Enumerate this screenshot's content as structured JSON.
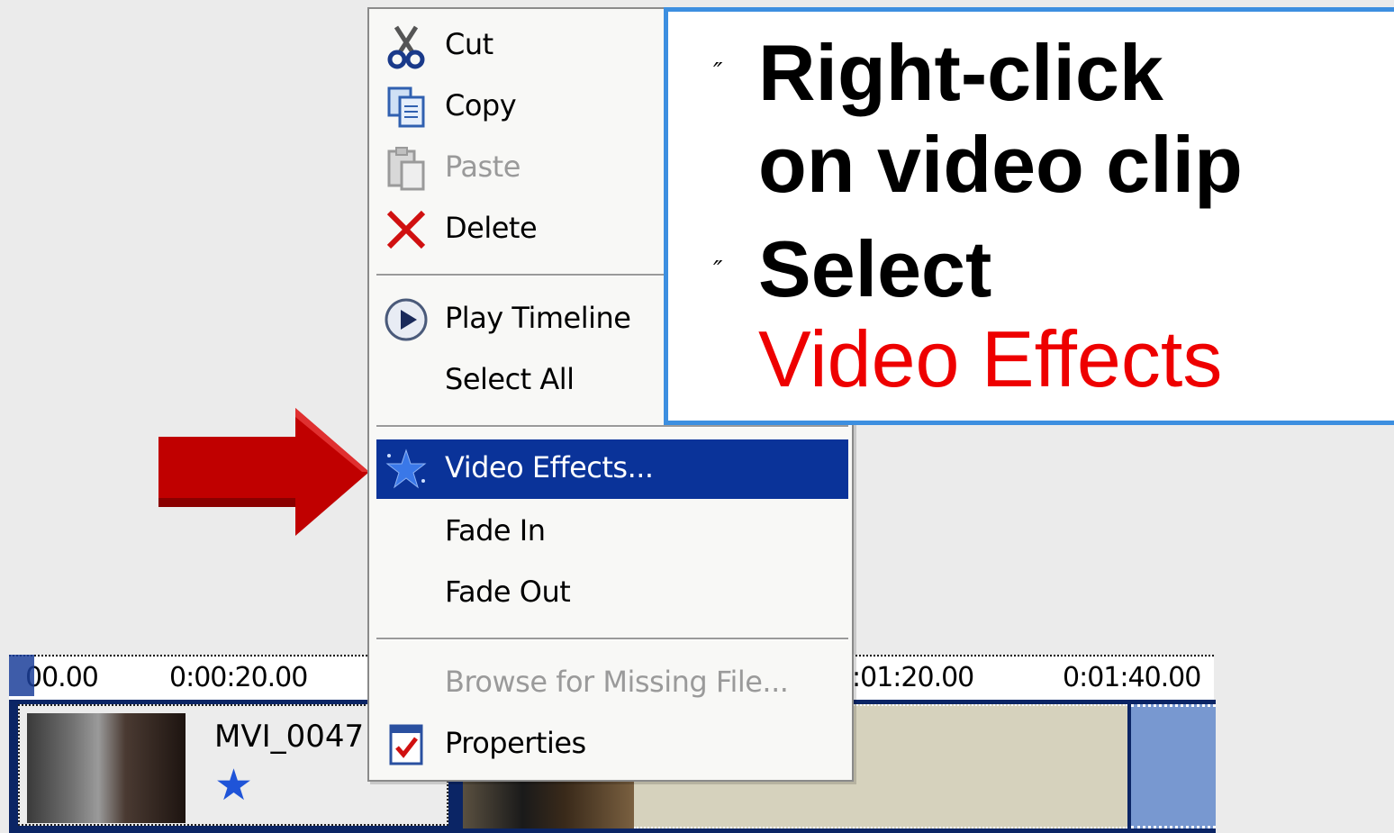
{
  "timeline": {
    "ruler_labels": [
      "00.00",
      "0:00:20.00",
      ":01:20.00",
      "0:01:40.00"
    ],
    "clip1_name": "MVI_0047",
    "effect_icon": "star-icon"
  },
  "context_menu": {
    "items": [
      {
        "label": "Cut",
        "icon": "scissors-icon",
        "enabled": true
      },
      {
        "label": "Copy",
        "icon": "copy-icon",
        "enabled": true
      },
      {
        "label": "Paste",
        "icon": "paste-icon",
        "enabled": false
      },
      {
        "label": "Delete",
        "icon": "delete-x-icon",
        "enabled": true
      },
      {
        "label": "Play Timeline",
        "icon": "play-icon",
        "enabled": true
      },
      {
        "label": "Select All",
        "icon": "",
        "enabled": true
      },
      {
        "label": "Video Effects...",
        "icon": "video-effects-star-icon",
        "enabled": true,
        "highlighted": true
      },
      {
        "label": "Fade In",
        "icon": "",
        "enabled": true
      },
      {
        "label": "Fade Out",
        "icon": "",
        "enabled": true
      },
      {
        "label": "Browse for Missing File...",
        "icon": "",
        "enabled": false
      },
      {
        "label": "Properties",
        "icon": "properties-icon",
        "enabled": true
      }
    ]
  },
  "callout": {
    "bullet": "″",
    "step1_line1": "Right-click",
    "step1_line2": "on video clip",
    "step2_line1": "Select",
    "step2_line2": "Video Effects"
  },
  "colors": {
    "highlight": "#0a3399",
    "callout_border": "#3d8fe0",
    "accent_red": "#ee0000",
    "arrow_red": "#c00000"
  }
}
